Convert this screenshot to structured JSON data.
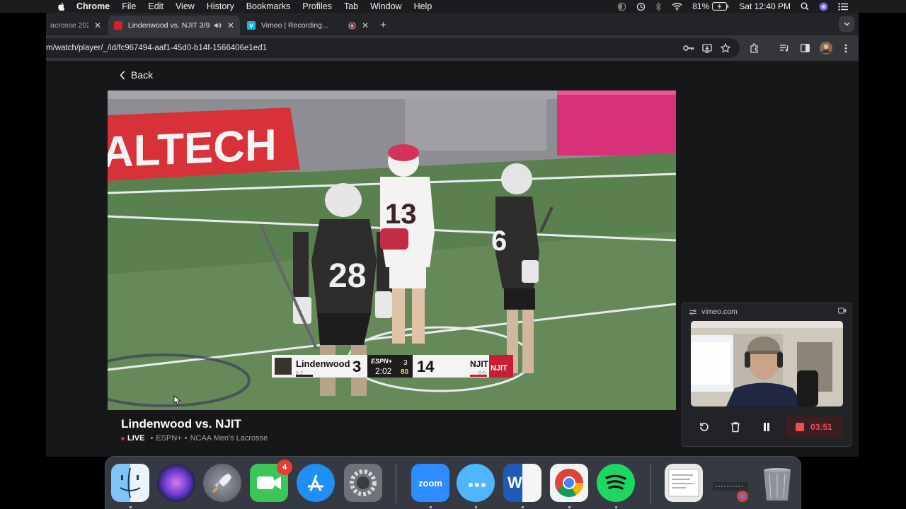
{
  "menubar": {
    "app_name": "Chrome",
    "items": [
      "File",
      "Edit",
      "View",
      "History",
      "Bookmarks",
      "Profiles",
      "Tab",
      "Window",
      "Help"
    ],
    "battery": "81%",
    "clock": "Sat 12:40 PM"
  },
  "tabs": [
    {
      "title": "acrosse 202",
      "active": false
    },
    {
      "title": "Lindenwood vs. NJIT 3/9/",
      "active": true
    },
    {
      "title": "Vimeo | Recording...",
      "active": false
    }
  ],
  "toolbar": {
    "url": "m/watch/player/_/id/fc967494-aaf1-45d0-b14f-1566406e1ed1"
  },
  "page": {
    "back_label": "Back",
    "event_title": "Lindenwood vs. NJIT",
    "live_label": "LIVE",
    "network": "ESPN+",
    "league": "NCAA Men's Lacrosse"
  },
  "scorebug": {
    "home_team": "Lindenwood",
    "home_record": "0-2",
    "home_score": "3",
    "network_logo": "ESPN+",
    "clock": "2:02",
    "quarter": "3",
    "shot_clock": "80",
    "away_score": "14",
    "away_team": "NJIT",
    "away_record": "5-0",
    "away_logo_text": "NJIT"
  },
  "video_text": {
    "banner_left": "ALTECH",
    "player_number_1": "28",
    "player_number_2": "13",
    "player_number_3": "6"
  },
  "recorder": {
    "site": "vimeo.com",
    "elapsed": "03:51"
  },
  "dock": {
    "facetime_badge": "4",
    "zoom_label": "zoom",
    "word_letter": "W"
  },
  "colors": {
    "accent_red": "#ef4e55",
    "live_red": "#e22b2b",
    "field_green": "#5b7f4e",
    "scorebug_bg": "#f4f4f4"
  }
}
